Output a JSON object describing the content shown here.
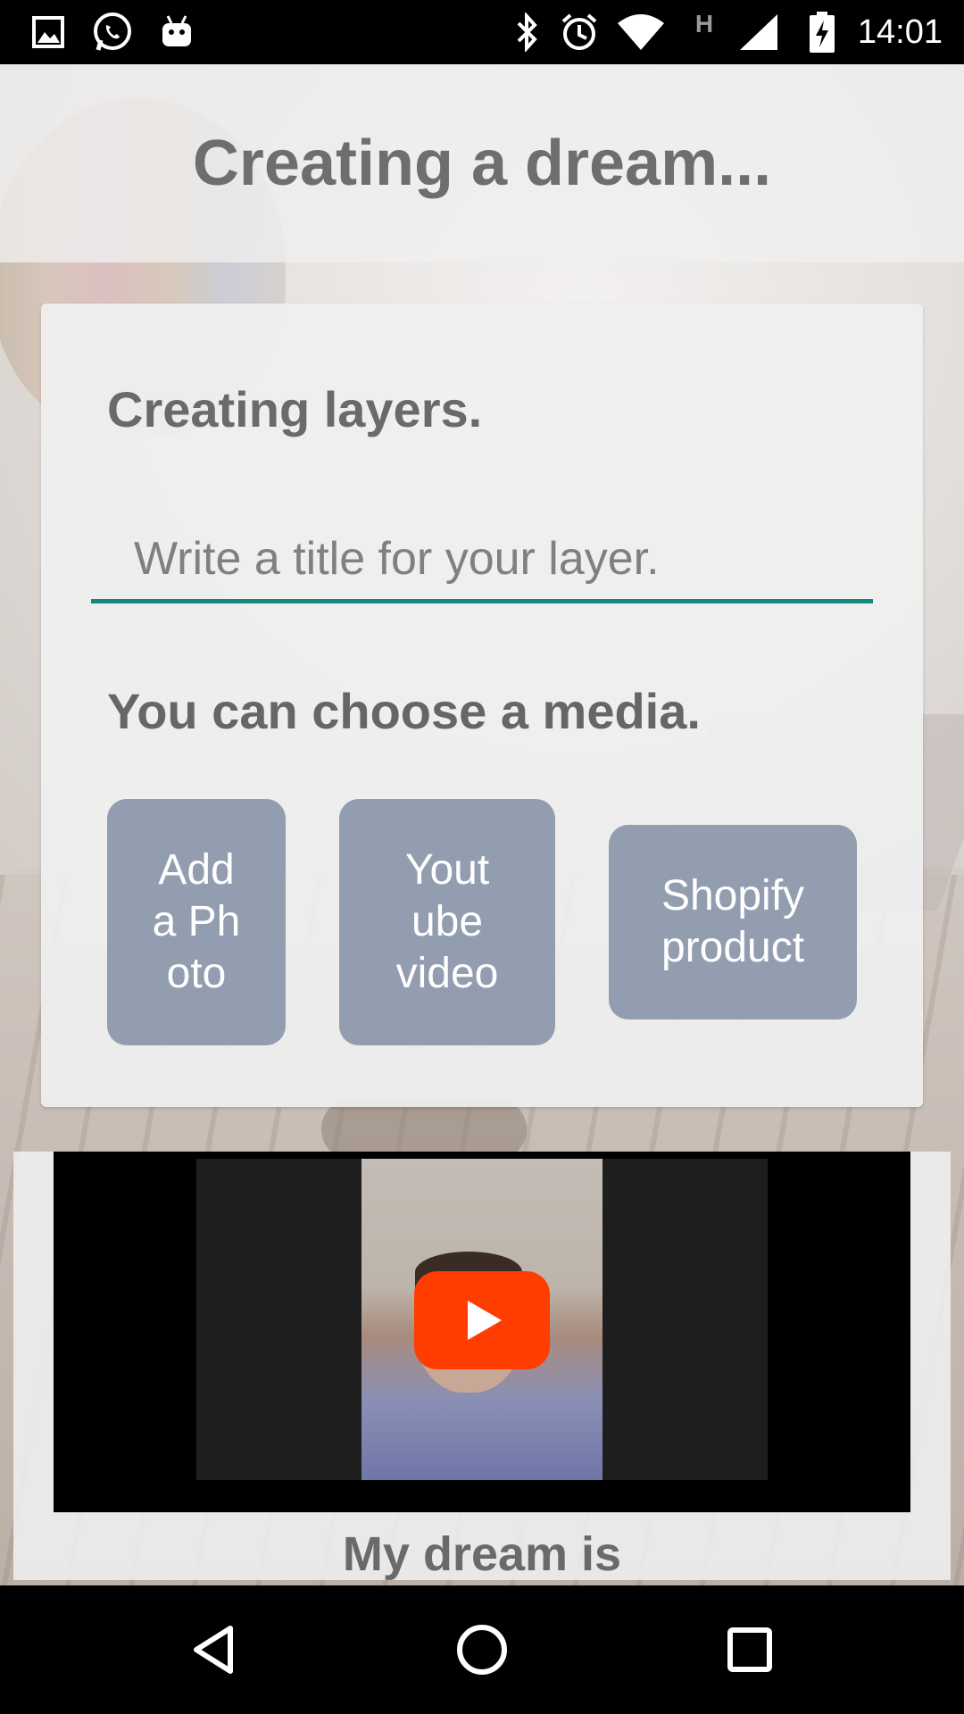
{
  "status_bar": {
    "time": "14:01",
    "left_icons": [
      "image-icon",
      "whatsapp-icon",
      "android-icon"
    ],
    "right_icons": [
      "bluetooth-icon",
      "alarm-icon",
      "wifi-icon",
      "signal-h-icon",
      "cell-signal-icon",
      "battery-charging-icon"
    ],
    "network_label": "H"
  },
  "header": {
    "title": "Creating a dream..."
  },
  "card": {
    "heading": "Creating layers.",
    "title_input": {
      "value": "",
      "placeholder": "Write a title for your layer."
    },
    "media_heading": "You can choose a media.",
    "buttons": {
      "photo": "Add\na Ph\noto",
      "youtube": "Yout\nube\nvideo",
      "shopify": "Shopify\nproduct"
    }
  },
  "video": {
    "caption": "My dream is"
  },
  "colors": {
    "accent_underline": "#14897f",
    "media_button": "#929daf",
    "play_button": "#ff3d00",
    "text_gray": "#6e6e6e"
  },
  "nav_bar": {
    "icons": [
      "back-icon",
      "home-icon",
      "recents-icon"
    ]
  }
}
